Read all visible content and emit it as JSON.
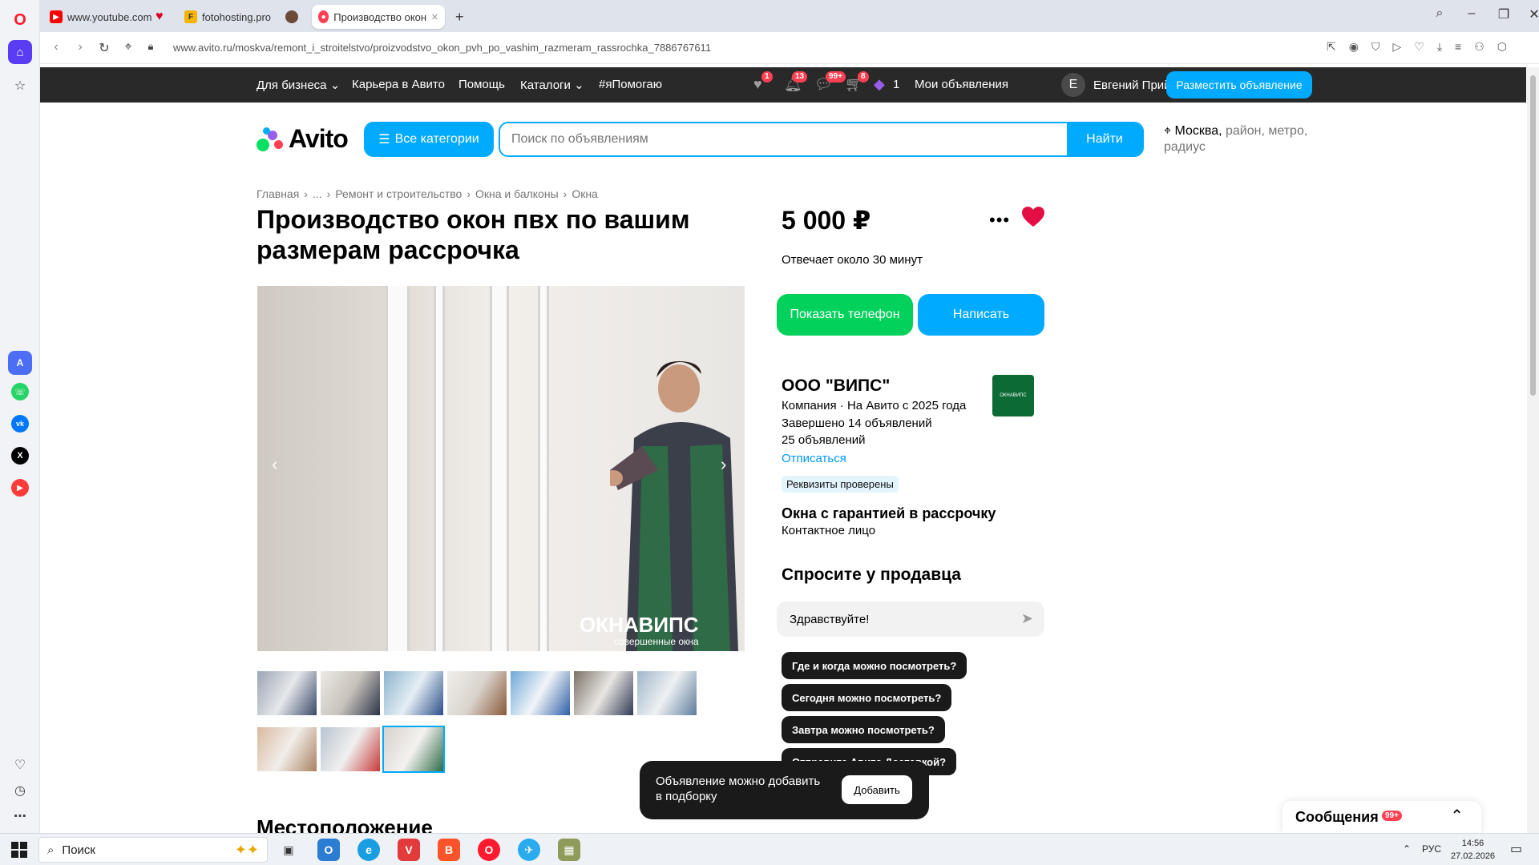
{
  "browser": {
    "tabs": [
      {
        "label": "www.youtube.com"
      },
      {
        "label": "fotohosting.pro"
      },
      {
        "label": "Производство окон пвх"
      }
    ],
    "url": "www.avito.ru/moskva/remont_i_stroitelstvo/proizvodstvo_okon_pvh_po_vashim_razmeram_rassrochka_7886767611"
  },
  "topbar": {
    "for_business": "Для бизнеса",
    "career": "Карьера в Авито",
    "help": "Помощь",
    "catalogs": "Каталоги",
    "ihelp": "#яПомогаю",
    "favorites_count": "1",
    "notifications_count": "13",
    "messages_count": "99+",
    "cart_count": "8",
    "bonus_count": "1",
    "my_ads": "Мои объявления",
    "avatar_letter": "Е",
    "user_name": "Евгений Прий...",
    "post_ad": "Разместить объявление"
  },
  "header": {
    "logo": "Avito",
    "all_categories": "Все категории",
    "search_placeholder": "Поиск по объявлениям",
    "search_button": "Найти",
    "location_city": "Москва,",
    "location_rest": " район, метро, радиус"
  },
  "breadcrumbs": [
    "Главная",
    "...",
    "Ремонт и строительство",
    "Окна и балконы",
    "Окна"
  ],
  "listing": {
    "title": "Производство окон пвх по вашим размерам рассрочка",
    "price": "5 000 ₽",
    "reply_time": "Отвечает около 30 минут",
    "show_phone": "Показать телефон",
    "write": "Написать",
    "watermark_main": "ОКНАВИПС",
    "watermark_sub": "совершенные окна",
    "location_heading": "Местоположение"
  },
  "seller": {
    "name": "ООО \"ВИПС\"",
    "info": "Компания · На Авито с 2025 года",
    "completed": "Завершено 14 объявлений",
    "active": "25 объявлений",
    "unsubscribe": "Отписаться",
    "verified": "Реквизиты проверены",
    "shop_name": "Окна с гарантией в рассрочку",
    "contact": "Контактное лицо",
    "logo_text": "ОКНАВИПС"
  },
  "ask": {
    "heading": "Спросите у продавца",
    "message": "Здравствуйте!",
    "questions": [
      "Где и когда можно посмотреть?",
      "Сегодня можно посмотреть?",
      "Завтра можно посмотреть?",
      "Отправите Авито Доставкой?"
    ]
  },
  "toast": {
    "text": "Объявление можно добавить в подборку",
    "button": "Добавить"
  },
  "messages_popup": {
    "label": "Сообщения",
    "badge": "99+"
  },
  "taskbar": {
    "search": "Поиск",
    "lang": "РУС",
    "time": "14:56",
    "date": "27.02.2026"
  }
}
